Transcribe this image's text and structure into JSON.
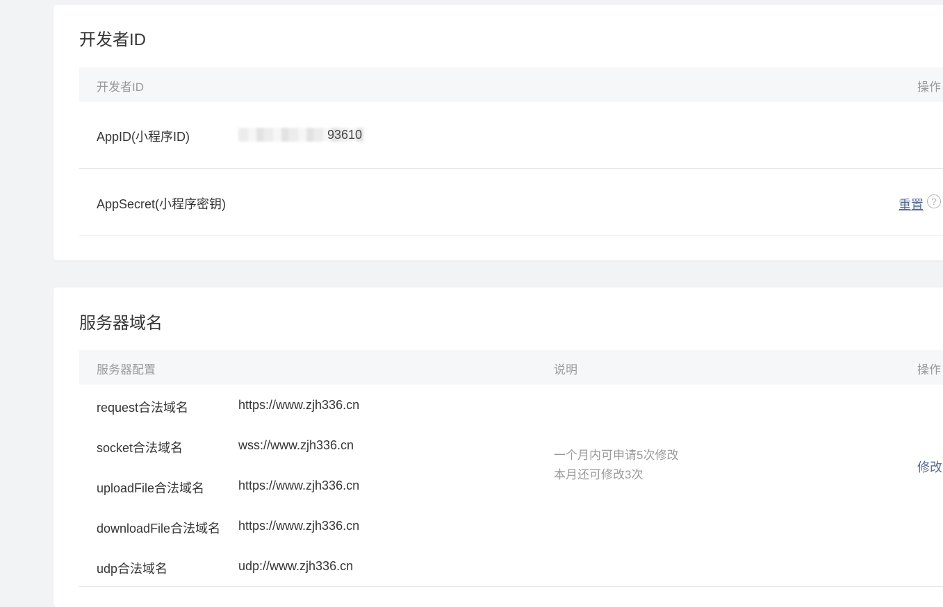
{
  "developer_id": {
    "title": "开发者ID",
    "table_header": {
      "name": "开发者ID",
      "action": "操作"
    },
    "rows": [
      {
        "label": "AppID(小程序ID)",
        "value_visible": "93610"
      },
      {
        "label": "AppSecret(小程序密钥)",
        "action_label": "重置",
        "help_icon": "?"
      }
    ]
  },
  "server_domain": {
    "title": "服务器域名",
    "table_header": {
      "config": "服务器配置",
      "description": "说明",
      "action": "操作"
    },
    "items": [
      {
        "label": "request合法域名",
        "value": "https://www.zjh336.cn"
      },
      {
        "label": "socket合法域名",
        "value": "wss://www.zjh336.cn"
      },
      {
        "label": "uploadFile合法域名",
        "value": "https://www.zjh336.cn"
      },
      {
        "label": "downloadFile合法域名",
        "value": "https://www.zjh336.cn"
      },
      {
        "label": "udp合法域名",
        "value": "udp://www.zjh336.cn"
      }
    ],
    "note_line1": "一个月内可申请5次修改",
    "note_line2": "本月还可修改3次",
    "modify_label": "修改"
  },
  "colors": {
    "link": "#576b95",
    "header_bg": "#f6f7f9",
    "page_bg": "#f2f3f5"
  }
}
